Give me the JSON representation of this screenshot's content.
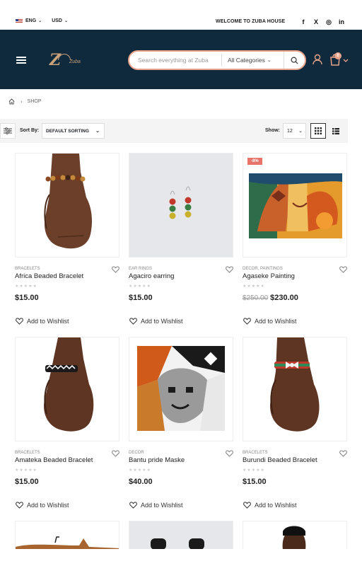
{
  "topbar": {
    "language": "ENG",
    "currency": "USD",
    "welcome": "WELCOME TO ZUBA HOUSE",
    "social": [
      "f",
      "X",
      "◎",
      "in"
    ]
  },
  "header": {
    "logo_text": "Zuba",
    "search_placeholder": "Search everything at Zuba",
    "category": "All Categories",
    "cart_count": "0",
    "bg_color": "#0f2a3d",
    "accent_color": "#e8a38a"
  },
  "breadcrumb": {
    "current": "SHOP"
  },
  "toolbar": {
    "sort_label": "Sort By:",
    "sort_value": "DEFAULT SORTING",
    "show_label": "Show:",
    "show_value": "12"
  },
  "products": [
    {
      "category": "BRACELETS",
      "name": "Africa Beaded Bracelet",
      "price": "$15.00",
      "wishlist": "Add to Wishlist"
    },
    {
      "category": "EAR RINGS",
      "name": "Agaciro earring",
      "price": "$15.00",
      "wishlist": "Add to Wishlist"
    },
    {
      "category": "DECOR, PAINTINGS",
      "name": "Agaseke Painting",
      "old_price": "$250.00",
      "price": "$230.00",
      "sale": "-8%",
      "wishlist": "Add to Wishlist"
    },
    {
      "category": "BRACELETS",
      "name": "Amateka Beaded Bracelet",
      "price": "$15.00",
      "wishlist": "Add to Wishlist"
    },
    {
      "category": "DECOR",
      "name": "Bantu pride Maske",
      "price": "$40.00",
      "wishlist": "Add to Wishlist"
    },
    {
      "category": "BRACELETS",
      "name": "Burundi Beaded Bracelet",
      "price": "$15.00",
      "wishlist": "Add to Wishlist"
    }
  ]
}
